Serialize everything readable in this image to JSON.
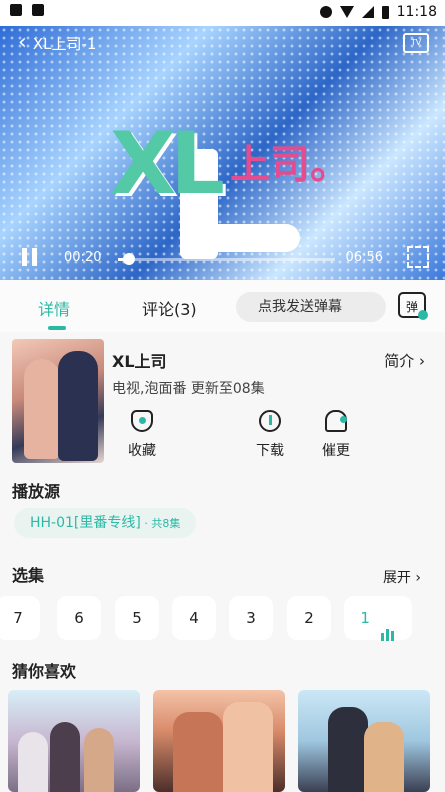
{
  "status": {
    "time": "11:18"
  },
  "player": {
    "title": "XL上司-1",
    "tv_label": "TV",
    "current_time": "00:20",
    "duration": "06:56",
    "progress": 0.05,
    "logo": {
      "xl": "XL",
      "shangsi": "上司。"
    }
  },
  "tabs": [
    {
      "label": "详情",
      "active": true
    },
    {
      "label": "评论(3)",
      "active": false
    }
  ],
  "danmu": {
    "placeholder": "点我发送弹幕",
    "button": "弹"
  },
  "anime": {
    "title": "XL上司",
    "meta": "电视,泡面番 更新至08集",
    "intro_label": "简介 ›"
  },
  "actions": [
    {
      "icon": "heart-icon",
      "label": "收藏"
    },
    {
      "icon": "download-icon",
      "label": "下载"
    },
    {
      "icon": "bell-icon",
      "label": "催更"
    }
  ],
  "sources": {
    "title": "播放源",
    "items": [
      {
        "label": "HH-01[里番专线]",
        "count": " · 共8集"
      }
    ]
  },
  "episodes": {
    "title": "选集",
    "expand_label": "展开 ›",
    "items": [
      "7",
      "6",
      "5",
      "4",
      "3",
      "2",
      "1"
    ]
  },
  "recommend": {
    "title": "猜你喜欢"
  },
  "colors": {
    "accent": "#2bb9a5"
  }
}
